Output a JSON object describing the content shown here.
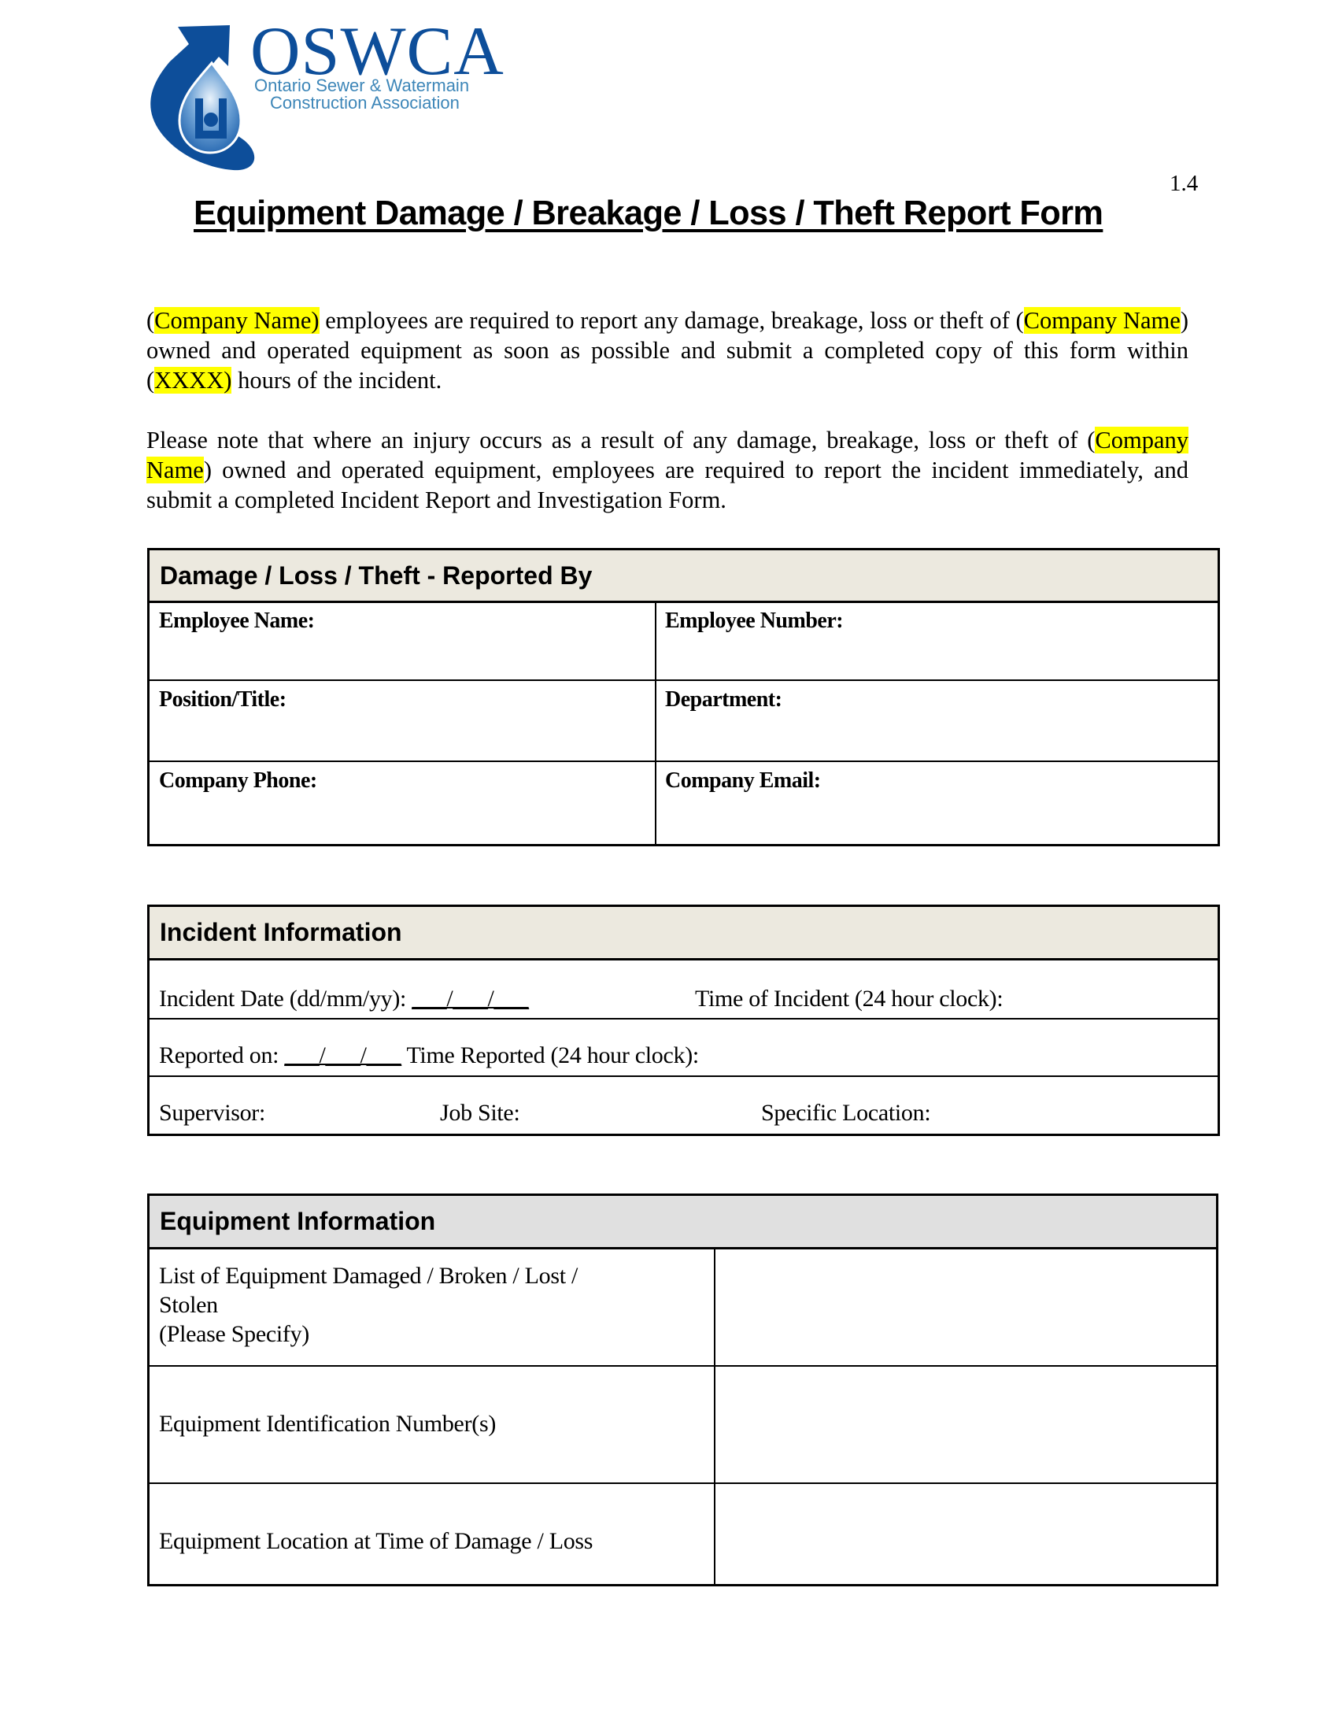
{
  "logo": {
    "wordmark": "OSWCA",
    "subtitle_line1": "Ontario Sewer & Watermain",
    "subtitle_line2": "Construction Association",
    "colors": {
      "primary": "#0d4e9a",
      "secondary": "#3d86b8"
    }
  },
  "version": "1.4",
  "title": "Equipment Damage / Breakage / Loss / Theft Report Form",
  "intro": {
    "para1": {
      "p1_open": "(",
      "hl1": "Company Name)",
      "p1_mid": " employees are required to report any damage, breakage, loss or theft of (",
      "hl2": "Company Name",
      "p1_mid2": ") owned and operated equipment as soon as possible and submit a completed copy of this form within (",
      "hl3": "XXXX)",
      "p1_end": " hours of the incident."
    },
    "para2": {
      "start": "Please note that where an injury occurs as a result of any damage, breakage, loss or theft of (",
      "hl": "Company Name",
      "end": ") owned and operated equipment, employees are required to report the incident immediately, and submit a completed Incident Report and Investigation Form."
    },
    "highlight_color": "#ffff00"
  },
  "reported_by": {
    "heading": "Damage / Loss / Theft - Reported By",
    "fields": [
      {
        "label": "Employee Name:",
        "value": ""
      },
      {
        "label": "Employee Number:",
        "value": ""
      },
      {
        "label": "Position/Title:",
        "value": ""
      },
      {
        "label": "Department:",
        "value": ""
      },
      {
        "label": "Company Phone:",
        "value": ""
      },
      {
        "label": "Company Email:",
        "value": ""
      }
    ],
    "header_color": "#ece9df"
  },
  "incident": {
    "heading": "Incident Information",
    "incident_date_label": "Incident Date (dd/mm/yy):",
    "date_blank": "___/___/___",
    "time_of_incident_label": "Time of Incident (24 hour clock):",
    "reported_on_label": "Reported on:",
    "reported_blank": "___/___/___",
    "time_reported_label": "Time Reported (24 hour clock):",
    "supervisor_label": "Supervisor:",
    "job_site_label": "Job Site:",
    "specific_location_label": "Specific Location:",
    "header_color": "#ece9df"
  },
  "equipment": {
    "heading": "Equipment Information",
    "rows": [
      {
        "label_line1": "List of Equipment Damaged / Broken / Lost /",
        "label_line2": "Stolen",
        "label_line3": "(Please Specify)",
        "value": ""
      },
      {
        "label_line1": "Equipment Identification Number(s)",
        "value": ""
      },
      {
        "label_line1": "Equipment Location at Time of Damage / Loss",
        "value": ""
      }
    ],
    "header_color": "#e0e0e0"
  }
}
